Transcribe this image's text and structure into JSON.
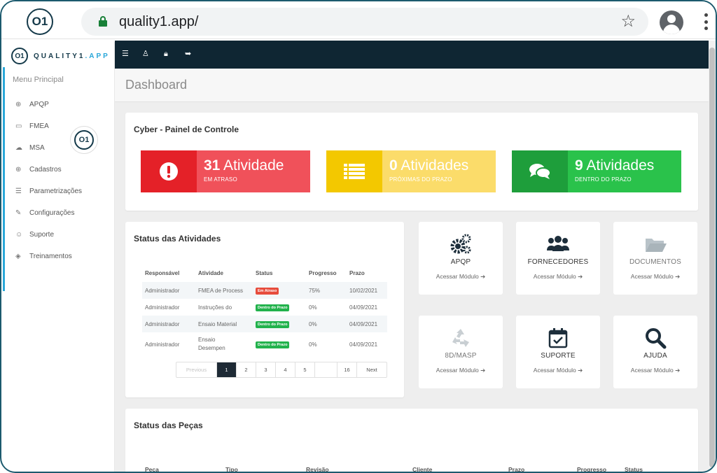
{
  "browser": {
    "url": "quality1.app/",
    "logo_text": "O1"
  },
  "colors": {
    "brand_dark": "#153a4a",
    "accent": "#29a7d9",
    "danger": "#f0515a",
    "warning": "#fbdc6a",
    "success": "#2ac24b"
  },
  "sidebar": {
    "brand_logo": "O1",
    "brand_name_a": "QUALITY1",
    "brand_name_b": ".APP",
    "menu_title": "Menu Principal",
    "items": [
      {
        "label": "APQP",
        "icon": "globe-icon"
      },
      {
        "label": "FMEA",
        "icon": "folder-icon"
      },
      {
        "label": "MSA",
        "icon": "cloud-icon"
      },
      {
        "label": "Cadastros",
        "icon": "plus-circle-icon"
      },
      {
        "label": "Parametrizações",
        "icon": "list-icon"
      },
      {
        "label": "Configurações",
        "icon": "wrench-icon"
      },
      {
        "label": "Suporte",
        "icon": "user-support-icon"
      },
      {
        "label": "Treinamentos",
        "icon": "graduation-cap-icon"
      }
    ]
  },
  "page": {
    "title": "Dashboard"
  },
  "panel_control": {
    "title": "Cyber - Painel de Controle",
    "stats": [
      {
        "count": "31",
        "label": "Atividade",
        "sub": "EM ATRASO",
        "icon": "alert-icon"
      },
      {
        "count": "0",
        "label": "Atividades",
        "sub": "PRÓXIMAS DO PRAZO",
        "icon": "list-icon"
      },
      {
        "count": "9",
        "label": "Atividades",
        "sub": "DENTRO DO PRAZO",
        "icon": "chat-icon"
      }
    ]
  },
  "status_activities": {
    "title": "Status das Atividades",
    "columns": [
      "Responsável",
      "Atividade",
      "Status",
      "Progresso",
      "Prazo"
    ],
    "rows": [
      {
        "responsavel": "Administrador",
        "atividade": "FMEA de Process",
        "status": "Em Atraso",
        "progresso": "75%",
        "prazo": "10/02/2021"
      },
      {
        "responsavel": "Administrador",
        "atividade": "Instruções do",
        "status": "Dentro do Prazo",
        "progresso": "0%",
        "prazo": "04/09/2021"
      },
      {
        "responsavel": "Administrador",
        "atividade": "Ensaio Material",
        "status": "Dentro do Prazo",
        "progresso": "0%",
        "prazo": "04/09/2021"
      },
      {
        "responsavel": "Administrador",
        "atividade": "Ensaio Desempen",
        "status": "Dentro do Prazo",
        "progresso": "0%",
        "prazo": "04/09/2021"
      }
    ],
    "pager": {
      "previous": "Previous",
      "pages": [
        "1",
        "2",
        "3",
        "4",
        "5",
        "",
        "16"
      ],
      "next": "Next"
    }
  },
  "modules": {
    "link_label": "Acessar Módulo",
    "tiles": [
      {
        "title": "APQP",
        "icon": "gears-icon"
      },
      {
        "title": "FORNECEDORES",
        "icon": "users-icon"
      },
      {
        "title": "DOCUMENTOS",
        "icon": "folder-open-icon"
      },
      {
        "title": "8D/MASP",
        "icon": "recycle-icon"
      },
      {
        "title": "SUPORTE",
        "icon": "calendar-check-icon"
      },
      {
        "title": "AJUDA",
        "icon": "search-icon"
      }
    ]
  },
  "status_parts": {
    "title": "Status das Peças",
    "columns": [
      "Peça",
      "Tipo",
      "Revisão",
      "Cliente",
      "Prazo",
      "Progresso",
      "Status"
    ]
  }
}
